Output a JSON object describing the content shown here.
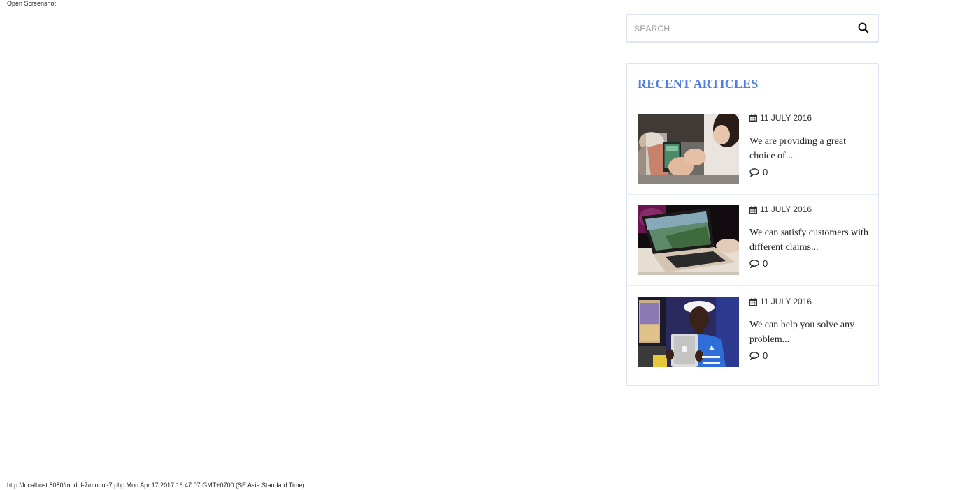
{
  "top_link": "Open Screenshot",
  "search": {
    "placeholder": "SEARCH",
    "value": ""
  },
  "recent_articles": {
    "title": "RECENT ARTICLES",
    "items": [
      {
        "date": "11 JULY 2016",
        "title": "We are providing a great choice of...",
        "comments": "0",
        "image": "hand-holding-phone"
      },
      {
        "date": "11 JULY 2016",
        "title": "We can satisfy customers with different claims...",
        "comments": "0",
        "image": "laptop-on-desk"
      },
      {
        "date": "11 JULY 2016",
        "title": "We can help you solve any problem...",
        "comments": "0",
        "image": "man-holding-tablet"
      }
    ]
  },
  "footer": {
    "info": "http://localhost:8080/modul-7/modul-7.php Mon Apr 17 2017 16:47:07 GMT+0700 (SE Asia Standard Time)"
  },
  "colors": {
    "accent": "#4f7fe0",
    "border": "#dde5f2",
    "separator": "#e8ecf3"
  }
}
